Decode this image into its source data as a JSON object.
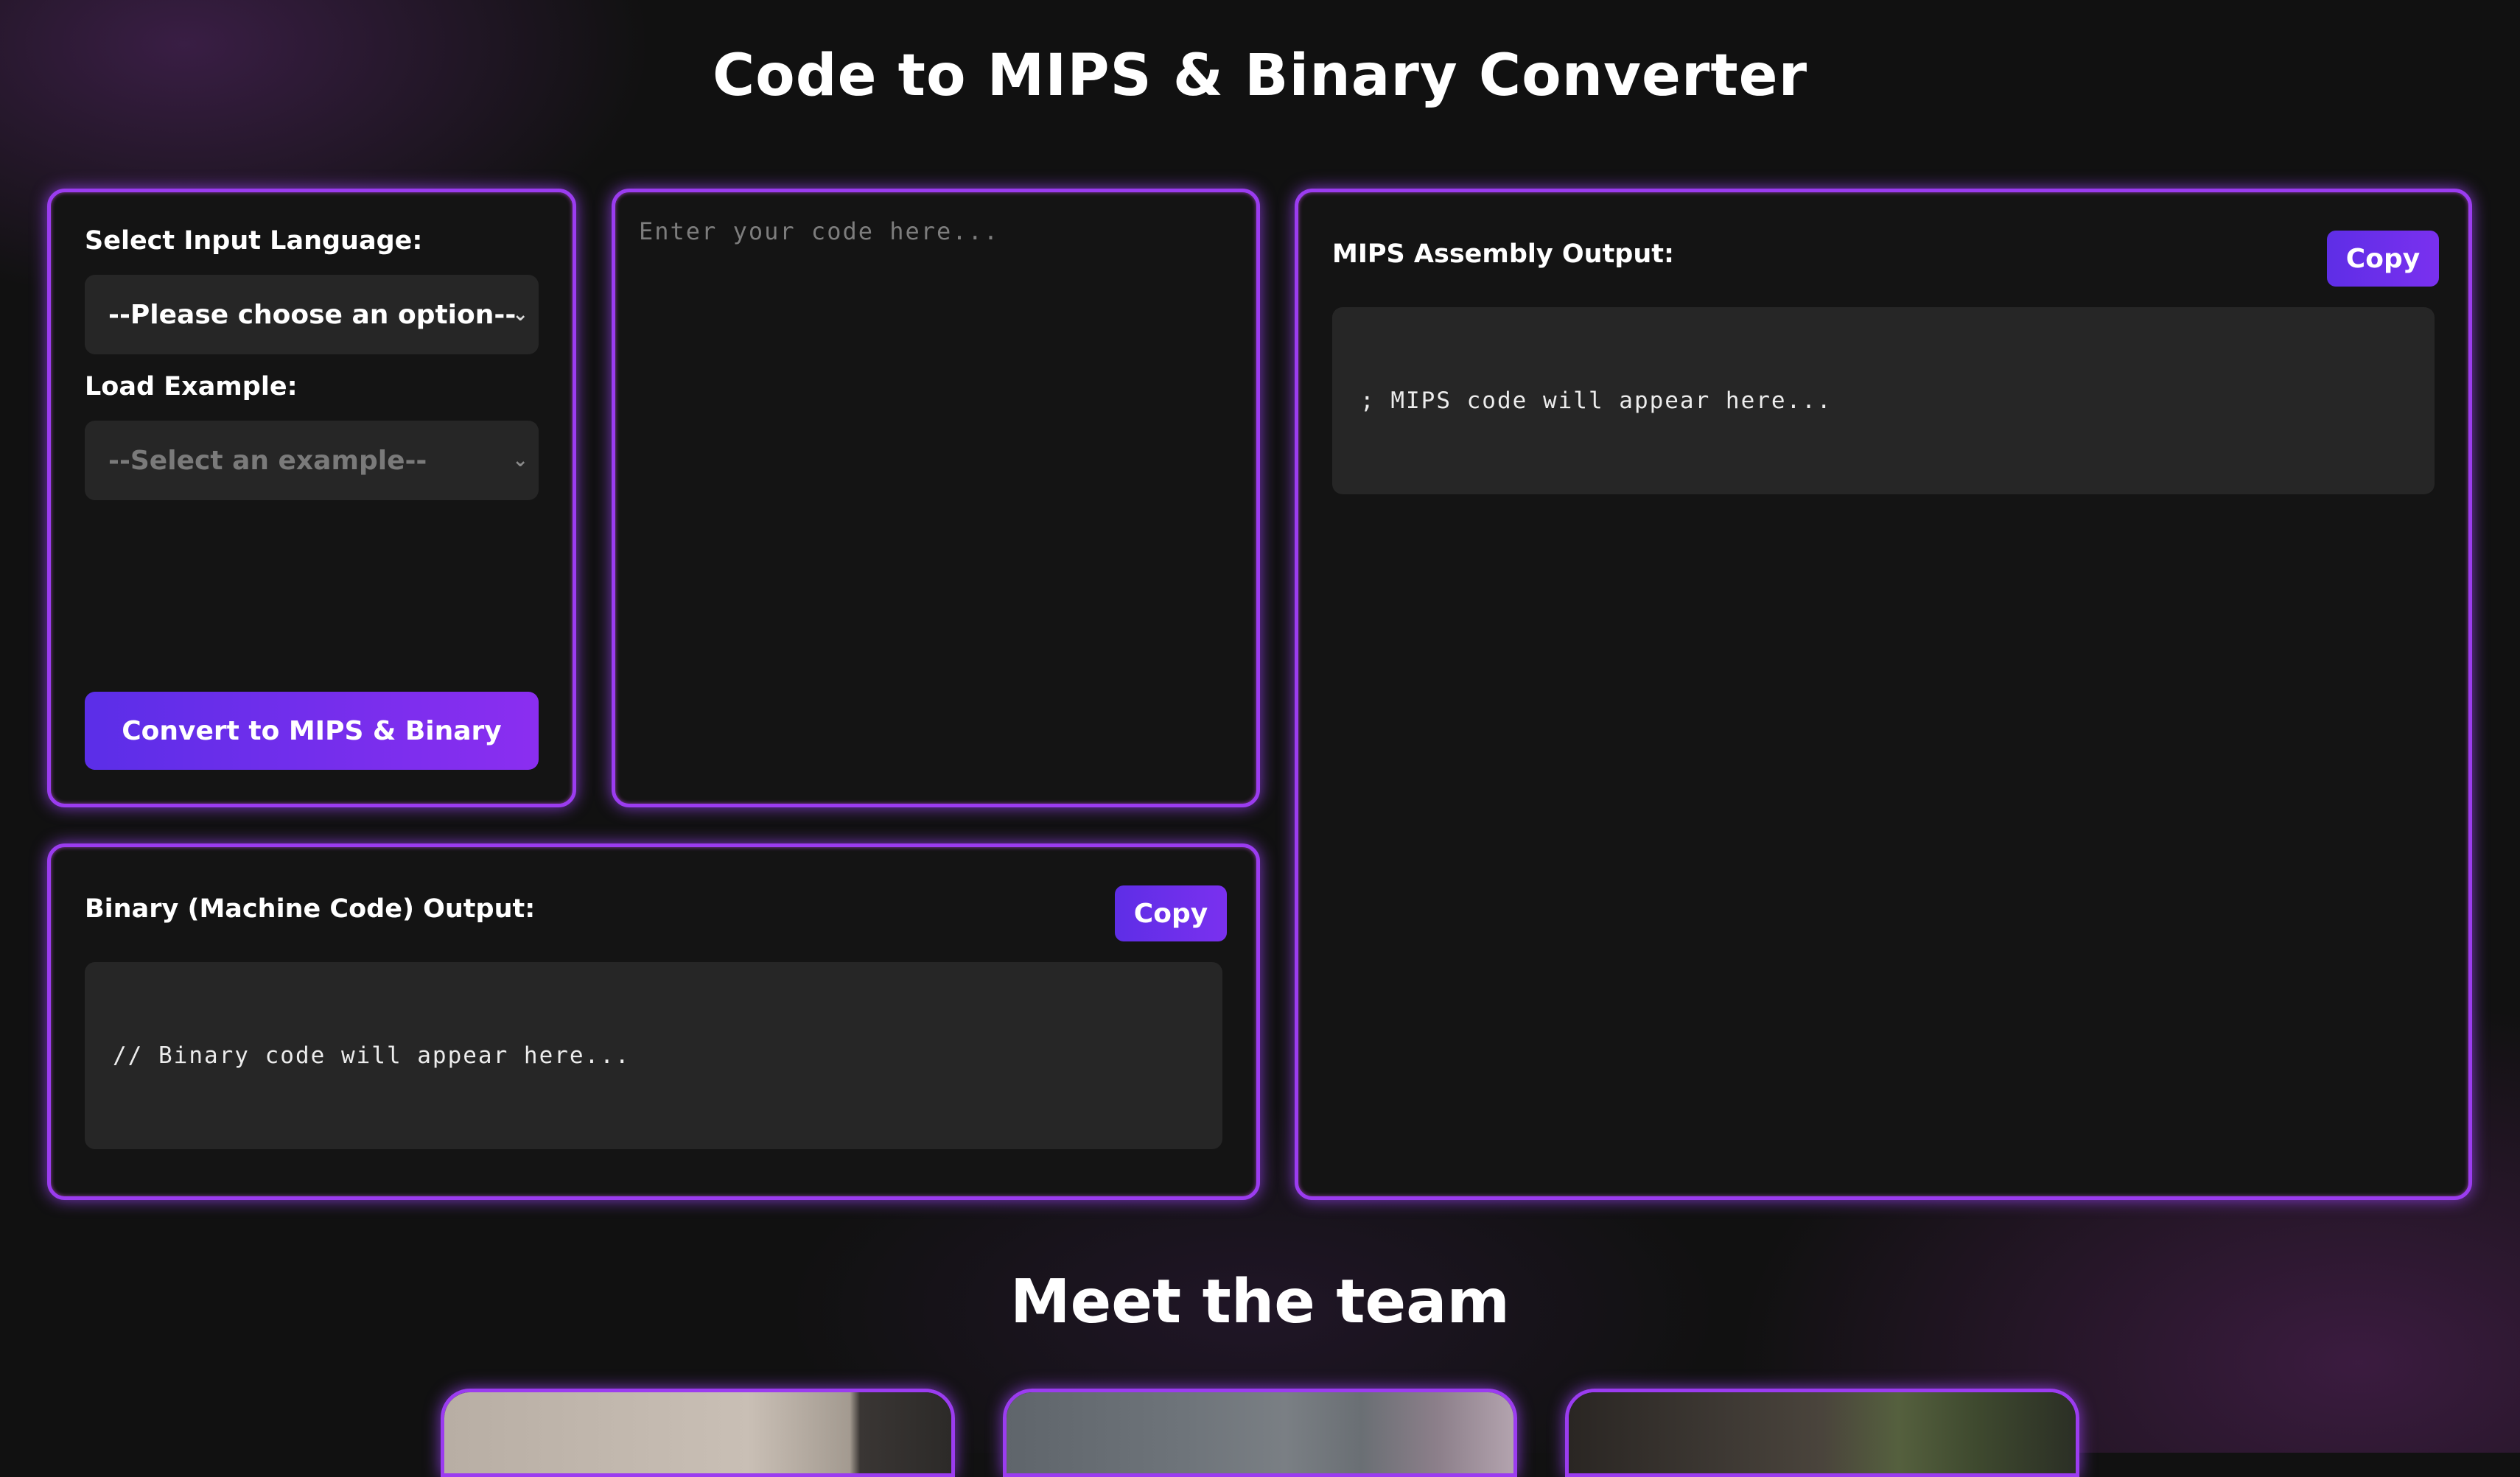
{
  "page": {
    "title": "Code to MIPS & Binary Converter"
  },
  "controls": {
    "language_label": "Select Input Language:",
    "language_selected": "--Please choose an option--",
    "example_label": "Load Example:",
    "example_selected": "--Select an example--",
    "convert_label": "Convert to MIPS & Binary"
  },
  "code_input": {
    "placeholder": "Enter your code here..."
  },
  "mips_output": {
    "label": "MIPS Assembly Output:",
    "copy_label": "Copy",
    "content": "; MIPS code will appear here..."
  },
  "binary_output": {
    "label": "Binary (Machine Code) Output:",
    "copy_label": "Copy",
    "content": "// Binary code will appear here..."
  },
  "team": {
    "heading": "Meet the team"
  },
  "icons": {
    "dropdown": "chevron-down-icon"
  },
  "colors": {
    "accent_border": "#9b3cf0",
    "button_start": "#5b2ee8",
    "button_end": "#8b2ef0",
    "background": "#111111",
    "field": "#262626"
  }
}
